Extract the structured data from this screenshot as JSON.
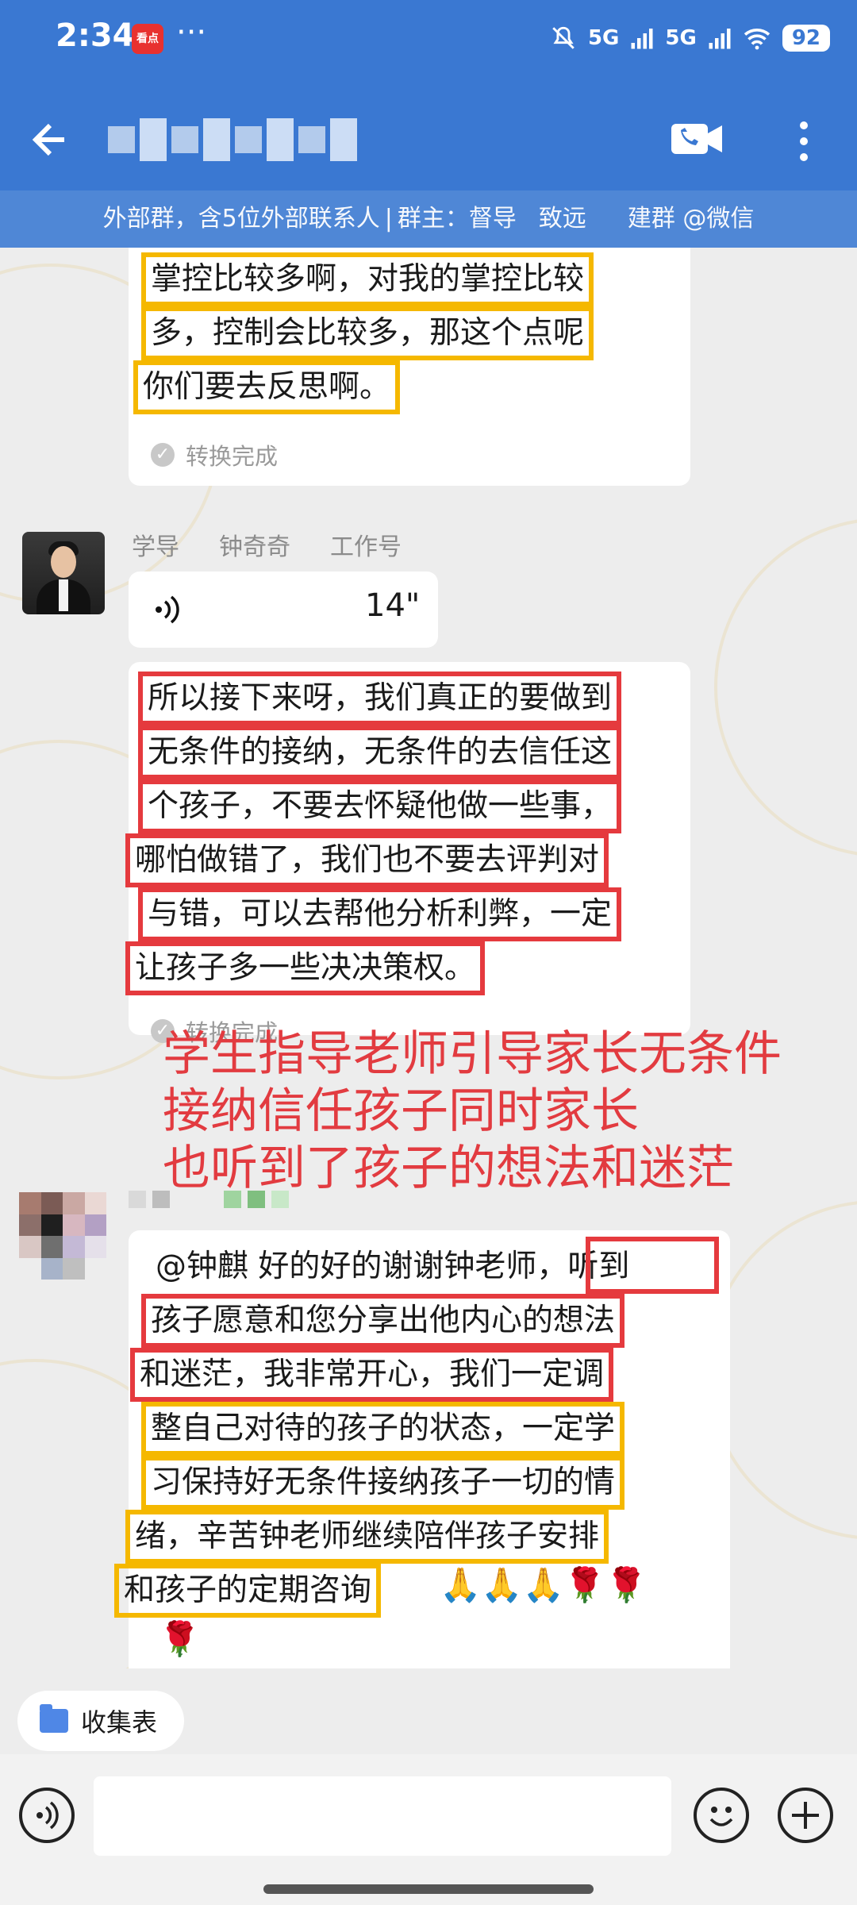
{
  "status_bar": {
    "time": "2:34",
    "app_badge": "看点",
    "dots": "···",
    "signal_1": "5G",
    "signal_2": "5G",
    "battery": "92"
  },
  "app_bar": {
    "group_info": [
      "外部群，含5位外部联系人",
      "|",
      "群主：督导",
      "致远",
      "建群 @微信"
    ]
  },
  "messages": {
    "first": {
      "lines": [
        "掌控比较多啊，对我的掌控比较",
        "多，控制会比较多，那这个点呢",
        "你们要去反思啊。"
      ],
      "converted": "转换完成"
    },
    "teacher": {
      "sender": [
        "学导",
        "钟奇奇",
        "工作号"
      ],
      "voice_duration": "14\"",
      "lines": [
        "所以接下来呀，我们真正的要做到",
        "无条件的接纳，无条件的去信任这",
        "个孩子，不要去怀疑他做一些事，",
        "哪怕做错了，我们也不要去评判对",
        "与错，可以去帮他分析利弊，一定",
        "让孩子多一些决决策权。"
      ],
      "converted": "转换完成"
    },
    "annotation": [
      "学生指导老师引导家长无条件",
      "接纳信任孩子同时家长",
      "也听到了孩子的想法和迷茫"
    ],
    "parent": {
      "lines": [
        "@钟麒 好的好的谢谢钟老师，听到",
        "孩子愿意和您分享出他内心的想法",
        "和迷茫，我非常开心，我们一定调",
        "整自己对待的孩子的状态，一定学",
        "习保持好无条件接纳孩子一切的情",
        "绪，辛苦钟老师继续陪伴孩子安排",
        "和孩子的定期咨询"
      ],
      "emojis": "🙏🙏🙏🌹🌹",
      "emoji_tail": "🌹"
    }
  },
  "bottom": {
    "form_chip_label": "收集表"
  }
}
